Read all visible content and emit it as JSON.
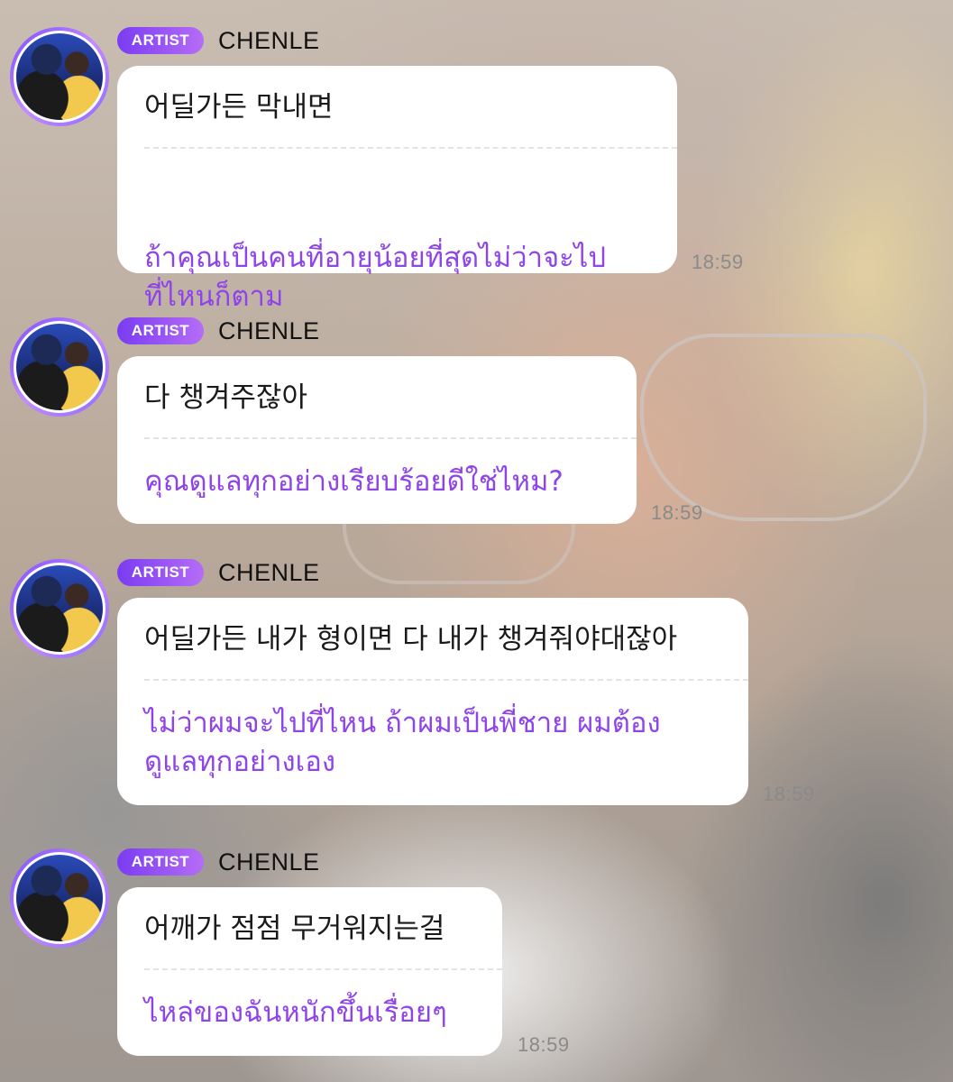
{
  "messages": [
    {
      "badge": "ARTIST",
      "sender": "CHENLE",
      "original": "어딜가든 막내면",
      "translation_lines": [
        "ถ้าคุณเป็นคนที่อายุน้อยที่สุดไม่ว่าจะไป",
        "ที่ไหนก็ตาม"
      ],
      "time": "18:59"
    },
    {
      "badge": "ARTIST",
      "sender": "CHENLE",
      "original": "다 챙겨주잖아",
      "translation_lines": [
        "คุณดูแลทุกอย่างเรียบร้อยดีใช่ไหม?"
      ],
      "time": "18:59"
    },
    {
      "badge": "ARTIST",
      "sender": "CHENLE",
      "original": "어딜가든 내가 형이면 다 내가 챙겨줘야대잖아",
      "translation_lines": [
        "ไม่ว่าผมจะไปที่ไหน ถ้าผมเป็นพี่ชาย ผมต้อง",
        "ดูแลทุกอย่างเอง"
      ],
      "time": "18:59"
    },
    {
      "badge": "ARTIST",
      "sender": "CHENLE",
      "original": "어깨가 점점 무거워지는걸",
      "translation_lines": [
        "ไหล่ของฉันหนักขึ้นเรื่อยๆ"
      ],
      "time": "18:59"
    }
  ],
  "colors": {
    "badge_start": "#7a3cf2",
    "badge_end": "#b56cf6",
    "translation_text": "#8f44ea",
    "bubble_bg": "#ffffff",
    "timestamp": "#8a8a8a"
  },
  "icons": {
    "avatar": "artist-avatar-photo"
  }
}
